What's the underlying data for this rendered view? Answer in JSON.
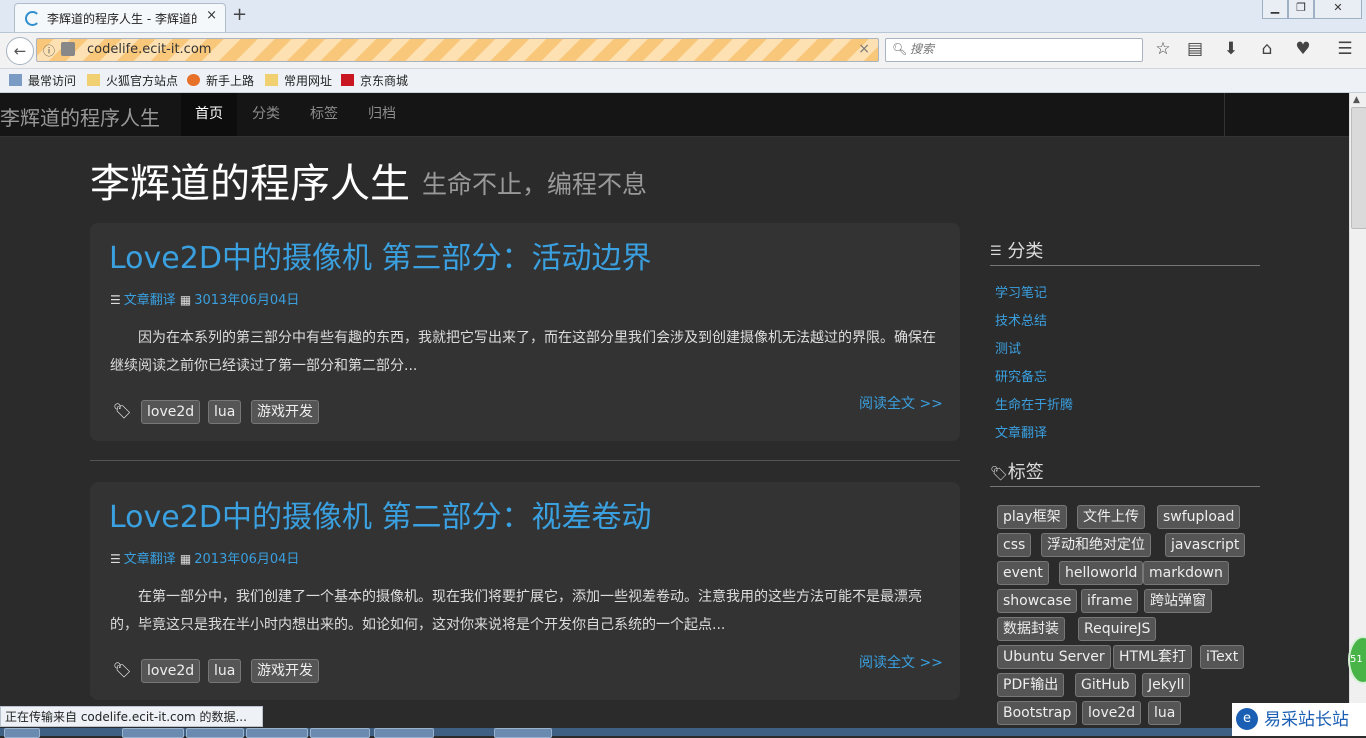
{
  "browser": {
    "tab_title": "李辉道的程序人生 - 李辉道的",
    "tab_close": "×",
    "new_tab": "+",
    "window_buttons": {
      "minimize": "▁",
      "maximize": "❐",
      "close": "✕"
    },
    "url": "codelife.ecit-it.com",
    "url_clear": "×",
    "search_placeholder": "搜索",
    "bookmarks": [
      "最常访问",
      "火狐官方站点",
      "新手上路",
      "常用网址",
      "京东商城"
    ],
    "toolbar_icons": [
      "star-icon",
      "reading-list-icon",
      "download-icon",
      "home-icon",
      "pocket-icon",
      "menu-icon"
    ],
    "status_text": "正在传输来自 codelife.ecit-it.com 的数据..."
  },
  "site": {
    "brand": "李辉道的程序人生",
    "nav": [
      "首页",
      "分类",
      "标签",
      "归档"
    ],
    "title": "李辉道的程序人生",
    "subtitle": "生命不止，编程不息",
    "read_more": "阅读全文 >>",
    "posts": [
      {
        "title": "Love2D中的摄像机 第三部分：活动边界",
        "category": "文章翻译",
        "date": "3013年06月04日",
        "excerpt": "因为在本系列的第三部分中有些有趣的东西，我就把它写出来了，而在这部分里我们会涉及到创建摄像机无法越过的界限。确保在继续阅读之前你已经读过了第一部分和第二部分...",
        "tags": [
          "love2d",
          "lua",
          "游戏开发"
        ]
      },
      {
        "title": "Love2D中的摄像机 第二部分：视差卷动",
        "category": "文章翻译",
        "date": "2013年06月04日",
        "excerpt": "在第一部分中，我们创建了一个基本的摄像机。现在我们将要扩展它，添加一些视差卷动。注意我用的这些方法可能不是最漂亮的，毕竟这只是我在半小时内想出来的。如论如何，这对你来说将是个开发你自己系统的一个起点...",
        "tags": [
          "love2d",
          "lua",
          "游戏开发"
        ]
      }
    ],
    "sidebar": {
      "categories_heading": "分类",
      "categories": [
        "学习笔记",
        "技术总结",
        "测试",
        "研究备忘",
        "生命在于折腾",
        "文章翻译"
      ],
      "tags_heading": "标签",
      "tags": [
        "play框架",
        "文件上传",
        "swfupload",
        "css",
        "浮动和绝对定位",
        "javascript",
        "event",
        "helloworld",
        "markdown",
        "showcase",
        "iframe",
        "跨站弹窗",
        "数据封装",
        "RequireJS",
        "Ubuntu Server",
        "HTML套打",
        "iText",
        "PDF输出",
        "GitHub",
        "Jekyll",
        "Bootstrap",
        "love2d",
        "lua"
      ]
    }
  },
  "overlay": {
    "badge": "51",
    "watermark": "易采站长站"
  }
}
